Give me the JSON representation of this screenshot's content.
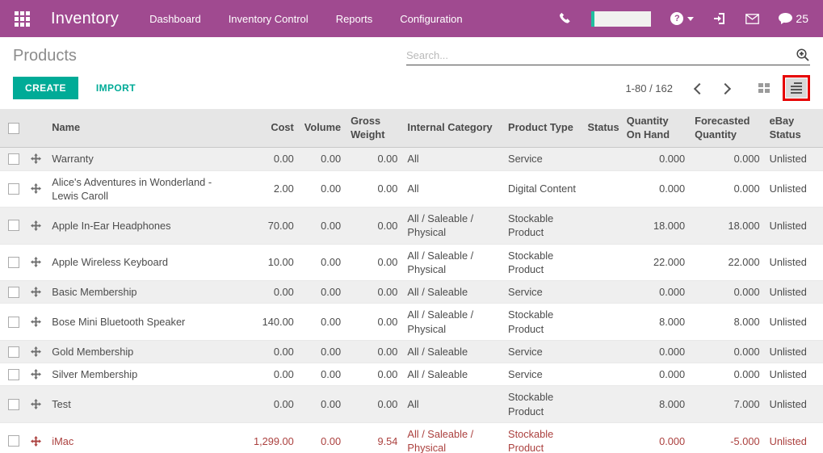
{
  "colors": {
    "brand": "#a04a90",
    "accent": "#00ab97",
    "danger": "#ab403e",
    "highlight": "#e60000"
  },
  "topbar": {
    "app_title": "Inventory",
    "menu": [
      "Dashboard",
      "Inventory Control",
      "Reports",
      "Configuration"
    ],
    "help_glyph": "?",
    "messages_count": "25"
  },
  "control_panel": {
    "page_title": "Products",
    "search_placeholder": "Search...",
    "create_label": "CREATE",
    "import_label": "IMPORT",
    "pager_text": "1-80 / 162"
  },
  "table": {
    "columns": {
      "name": "Name",
      "cost": "Cost",
      "volume": "Volume",
      "gross_weight": "Gross Weight",
      "internal_category": "Internal Category",
      "product_type": "Product Type",
      "status": "Status",
      "qty_on_hand": "Quantity On Hand",
      "forecasted_qty": "Forecasted Quantity",
      "ebay_status": "eBay Status"
    },
    "rows": [
      {
        "name": "Warranty",
        "cost": "0.00",
        "volume": "0.00",
        "gross_weight": "0.00",
        "internal_category": "All",
        "product_type": "Service",
        "status": "",
        "qty_on_hand": "0.000",
        "forecasted_qty": "0.000",
        "ebay_status": "Unlisted",
        "danger": false
      },
      {
        "name": "Alice's Adventures in Wonderland - Lewis Caroll",
        "cost": "2.00",
        "volume": "0.00",
        "gross_weight": "0.00",
        "internal_category": "All",
        "product_type": "Digital Content",
        "status": "",
        "qty_on_hand": "0.000",
        "forecasted_qty": "0.000",
        "ebay_status": "Unlisted",
        "danger": false
      },
      {
        "name": "Apple In-Ear Headphones",
        "cost": "70.00",
        "volume": "0.00",
        "gross_weight": "0.00",
        "internal_category": "All / Saleable / Physical",
        "product_type": "Stockable Product",
        "status": "",
        "qty_on_hand": "18.000",
        "forecasted_qty": "18.000",
        "ebay_status": "Unlisted",
        "danger": false
      },
      {
        "name": "Apple Wireless Keyboard",
        "cost": "10.00",
        "volume": "0.00",
        "gross_weight": "0.00",
        "internal_category": "All / Saleable / Physical",
        "product_type": "Stockable Product",
        "status": "",
        "qty_on_hand": "22.000",
        "forecasted_qty": "22.000",
        "ebay_status": "Unlisted",
        "danger": false
      },
      {
        "name": "Basic Membership",
        "cost": "0.00",
        "volume": "0.00",
        "gross_weight": "0.00",
        "internal_category": "All / Saleable",
        "product_type": "Service",
        "status": "",
        "qty_on_hand": "0.000",
        "forecasted_qty": "0.000",
        "ebay_status": "Unlisted",
        "danger": false
      },
      {
        "name": "Bose Mini Bluetooth Speaker",
        "cost": "140.00",
        "volume": "0.00",
        "gross_weight": "0.00",
        "internal_category": "All / Saleable / Physical",
        "product_type": "Stockable Product",
        "status": "",
        "qty_on_hand": "8.000",
        "forecasted_qty": "8.000",
        "ebay_status": "Unlisted",
        "danger": false
      },
      {
        "name": "Gold Membership",
        "cost": "0.00",
        "volume": "0.00",
        "gross_weight": "0.00",
        "internal_category": "All / Saleable",
        "product_type": "Service",
        "status": "",
        "qty_on_hand": "0.000",
        "forecasted_qty": "0.000",
        "ebay_status": "Unlisted",
        "danger": false
      },
      {
        "name": "Silver Membership",
        "cost": "0.00",
        "volume": "0.00",
        "gross_weight": "0.00",
        "internal_category": "All / Saleable",
        "product_type": "Service",
        "status": "",
        "qty_on_hand": "0.000",
        "forecasted_qty": "0.000",
        "ebay_status": "Unlisted",
        "danger": false
      },
      {
        "name": "Test",
        "cost": "0.00",
        "volume": "0.00",
        "gross_weight": "0.00",
        "internal_category": "All",
        "product_type": "Stockable Product",
        "status": "",
        "qty_on_hand": "8.000",
        "forecasted_qty": "7.000",
        "ebay_status": "Unlisted",
        "danger": false
      },
      {
        "name": "iMac",
        "cost": "1,299.00",
        "volume": "0.00",
        "gross_weight": "9.54",
        "internal_category": "All / Saleable / Physical",
        "product_type": "Stockable Product",
        "status": "",
        "qty_on_hand": "0.000",
        "forecasted_qty": "-5.000",
        "ebay_status": "Unlisted",
        "danger": true
      }
    ]
  }
}
